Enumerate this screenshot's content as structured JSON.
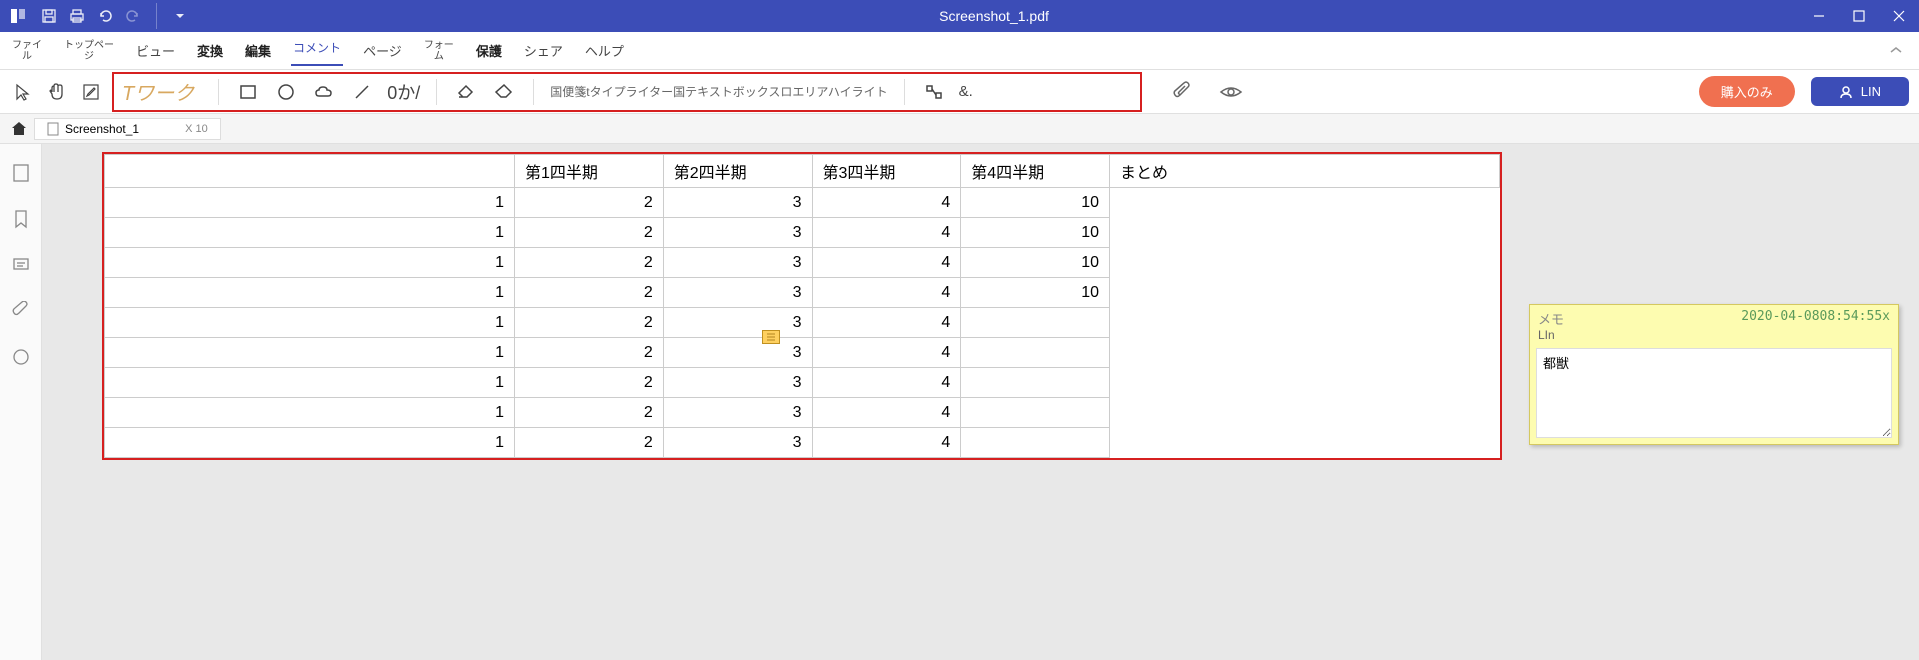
{
  "titlebar": {
    "filename": "Screenshot_1.pdf"
  },
  "menu": {
    "file": "ファイ\nル",
    "home": "トップペー\nジ",
    "view": "ビュー",
    "convert": "変換",
    "edit": "編集",
    "comment": "コメント",
    "page": "ページ",
    "form": "フォー\nム",
    "protect": "保護",
    "share": "シェア",
    "help": "ヘルプ"
  },
  "toolbar": {
    "twork": "Tワーク",
    "zero_ka": "0か/",
    "text_tools": "国便箋tタイプライター国テキストボックスロエリアハイライト",
    "amp": "&."
  },
  "tab": {
    "name": "Screenshot_1",
    "closeinfo": "X  10"
  },
  "buttons": {
    "purchase": "購入のみ",
    "user": "LIN"
  },
  "table": {
    "headers": [
      "第1四半期",
      "第2四半期",
      "第3四半期",
      "第4四半期",
      "まとめ"
    ],
    "rows": [
      [
        "1",
        "2",
        "3",
        "4",
        "10"
      ],
      [
        "1",
        "2",
        "3",
        "4",
        "10"
      ],
      [
        "1",
        "2",
        "3",
        "4",
        "10"
      ],
      [
        "1",
        "2",
        "3",
        "4",
        "10"
      ],
      [
        "1",
        "2",
        "3",
        "4",
        ""
      ],
      [
        "1",
        "2",
        "3",
        "4",
        ""
      ],
      [
        "1",
        "2",
        "3",
        "4",
        ""
      ],
      [
        "1",
        "2",
        "3",
        "4",
        ""
      ],
      [
        "1",
        "2",
        "3",
        "4",
        ""
      ]
    ]
  },
  "sticky": {
    "title": "メモ",
    "timestamp": "2020-04-0808:54:55x",
    "author": "LIn",
    "body": "都獣"
  }
}
